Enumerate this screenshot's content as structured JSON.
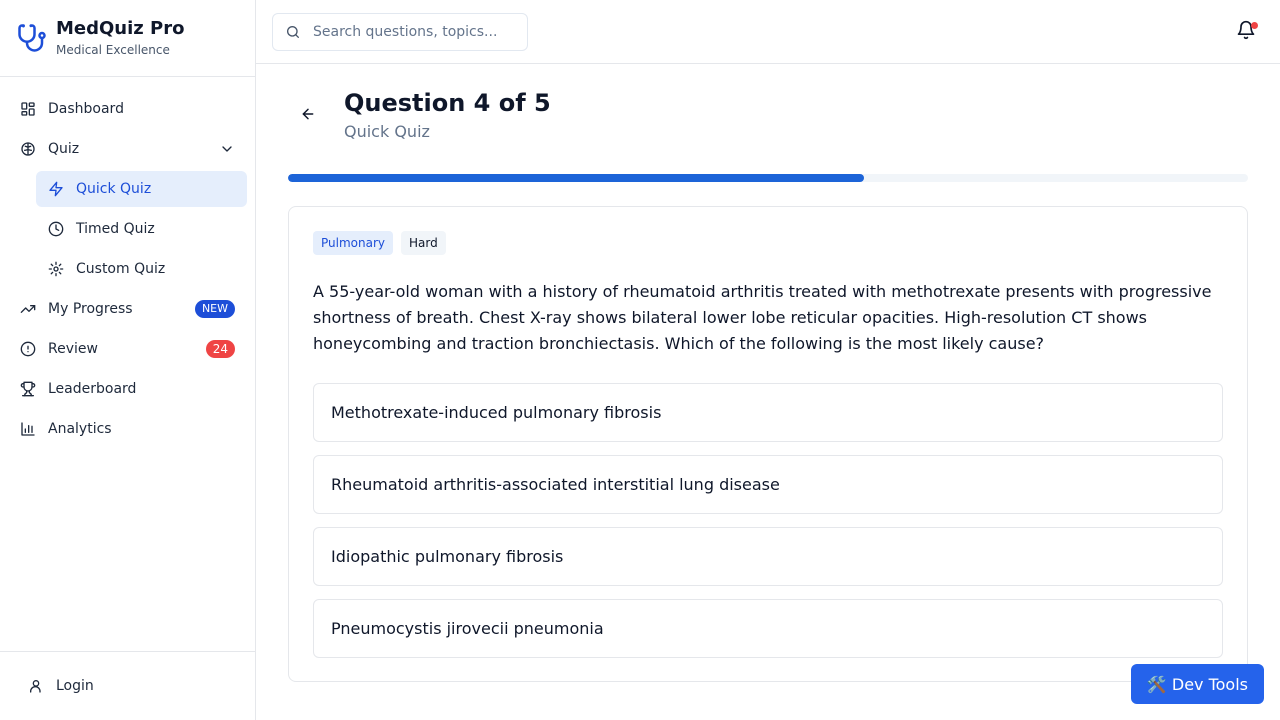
{
  "brand": {
    "name": "MedQuiz Pro",
    "tagline": "Medical Excellence",
    "icon": "stethoscope-icon",
    "accent": "#1d4ed8"
  },
  "sidebar": {
    "items": [
      {
        "label": "Dashboard",
        "icon": "dashboard-icon"
      },
      {
        "label": "Quiz",
        "icon": "brain-icon",
        "expanded": true
      },
      {
        "label": "Quick Quiz",
        "icon": "zap-icon",
        "active": true
      },
      {
        "label": "Timed Quiz",
        "icon": "clock-icon"
      },
      {
        "label": "Custom Quiz",
        "icon": "gear-icon"
      },
      {
        "label": "My Progress",
        "icon": "trending-icon",
        "badge": "NEW"
      },
      {
        "label": "Review",
        "icon": "alert-circle-icon",
        "badge": "24"
      },
      {
        "label": "Leaderboard",
        "icon": "trophy-icon"
      },
      {
        "label": "Analytics",
        "icon": "bar-chart-icon"
      }
    ],
    "footer": {
      "label": "Login",
      "icon": "user-icon"
    }
  },
  "header": {
    "search_placeholder": "Search questions, topics...",
    "notification_dot_color": "#ef4444"
  },
  "question": {
    "title": "Question 4 of 5",
    "subtitle": "Quick Quiz",
    "progress": 0.6,
    "category": "Pulmonary",
    "difficulty": "Hard",
    "text": "A 55-year-old woman with a history of rheumatoid arthritis treated with methotrexate presents with progressive shortness of breath. Chest X-ray shows bilateral lower lobe reticular opacities. High-resolution CT shows honeycombing and traction bronchiectasis. Which of the following is the most likely cause?",
    "options": [
      "Methotrexate-induced pulmonary fibrosis",
      "Rheumatoid arthritis-associated interstitial lung disease",
      "Idiopathic pulmonary fibrosis",
      "Pneumocystis jirovecii pneumonia"
    ]
  },
  "devtools": {
    "label": "🛠️ Dev Tools"
  }
}
